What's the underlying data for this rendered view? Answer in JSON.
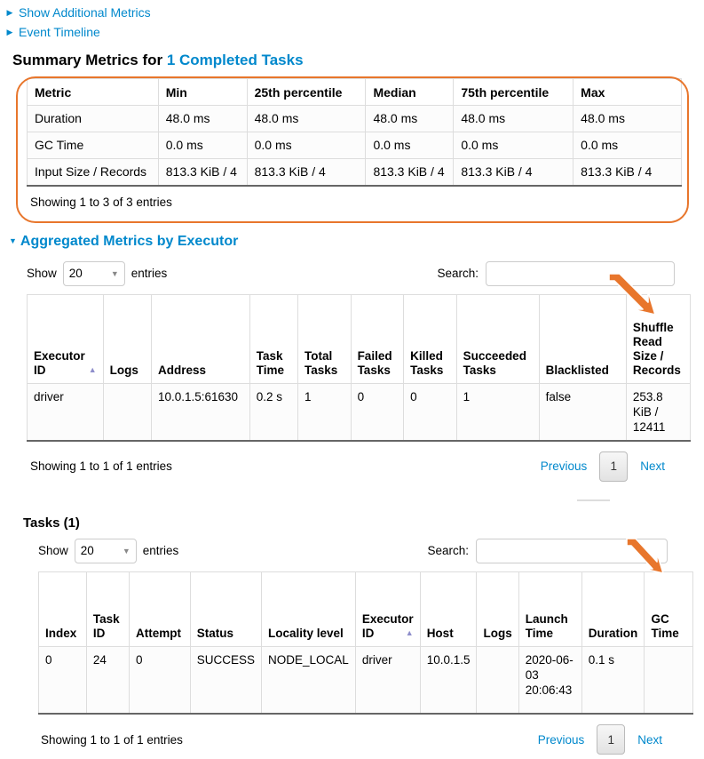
{
  "toggles": [
    {
      "label": "Show Additional Metrics",
      "icon": "caret-right-icon"
    },
    {
      "label": "Event Timeline",
      "icon": "caret-right-icon"
    }
  ],
  "summary_section": {
    "title_prefix": "Summary Metrics for ",
    "title_accent": "1 Completed Tasks",
    "headers": [
      "Metric",
      "Min",
      "25th percentile",
      "Median",
      "75th percentile",
      "Max"
    ],
    "rows": [
      [
        "Duration",
        "48.0 ms",
        "48.0 ms",
        "48.0 ms",
        "48.0 ms",
        "48.0 ms"
      ],
      [
        "GC Time",
        "0.0 ms",
        "0.0 ms",
        "0.0 ms",
        "0.0 ms",
        "0.0 ms"
      ],
      [
        "Input Size / Records",
        "813.3 KiB / 4",
        "813.3 KiB / 4",
        "813.3 KiB / 4",
        "813.3 KiB / 4",
        "813.3 KiB / 4"
      ]
    ],
    "showing": "Showing 1 to 3 of 3 entries",
    "highlight_color": "#e8762c"
  },
  "executor_section": {
    "title": "Aggregated Metrics by Executor",
    "caret": "caret-down-icon",
    "controls": {
      "show_label": "Show",
      "entries_label": "entries",
      "page_size": "20",
      "search_label": "Search:",
      "search_value": "",
      "search_placeholder": ""
    },
    "headers": [
      "Executor ID",
      "Logs",
      "Address",
      "Task Time",
      "Total Tasks",
      "Failed Tasks",
      "Killed Tasks",
      "Succeeded Tasks",
      "Blacklisted",
      "Shuffle Read Size / Records"
    ],
    "sorted_column_index": 0,
    "rows": [
      [
        "driver",
        "",
        "10.0.1.5:61630",
        "0.2 s",
        "1",
        "0",
        "0",
        "1",
        "false",
        "253.8 KiB / 12411"
      ]
    ],
    "showing": "Showing 1 to 1 of 1 entries",
    "pagination": {
      "previous": "Previous",
      "current": "1",
      "next": "Next"
    }
  },
  "tasks_section": {
    "title": "Tasks (1)",
    "controls": {
      "show_label": "Show",
      "entries_label": "entries",
      "page_size": "20",
      "search_label": "Search:",
      "search_value": "",
      "search_placeholder": ""
    },
    "headers": [
      "Index",
      "Task ID",
      "Attempt",
      "Status",
      "Locality level",
      "Executor ID",
      "Host",
      "Logs",
      "Launch Time",
      "Duration",
      "GC Time"
    ],
    "sorted_column_index": 5,
    "rows": [
      [
        "0",
        "24",
        "0",
        "SUCCESS",
        "NODE_LOCAL",
        "driver",
        "10.0.1.5",
        "",
        "2020-06-03 20:06:43",
        "0.1 s",
        ""
      ]
    ],
    "showing": "Showing 1 to 1 of 1 entries",
    "pagination": {
      "previous": "Previous",
      "current": "1",
      "next": "Next"
    }
  },
  "annotations": {
    "arrow_color": "#e8762c",
    "arrows": [
      {
        "name": "arrow-to-shuffle-read-column",
        "target": "Shuffle Read Size / Records"
      },
      {
        "name": "arrow-to-gc-time-column",
        "target": "GC Time"
      }
    ]
  }
}
